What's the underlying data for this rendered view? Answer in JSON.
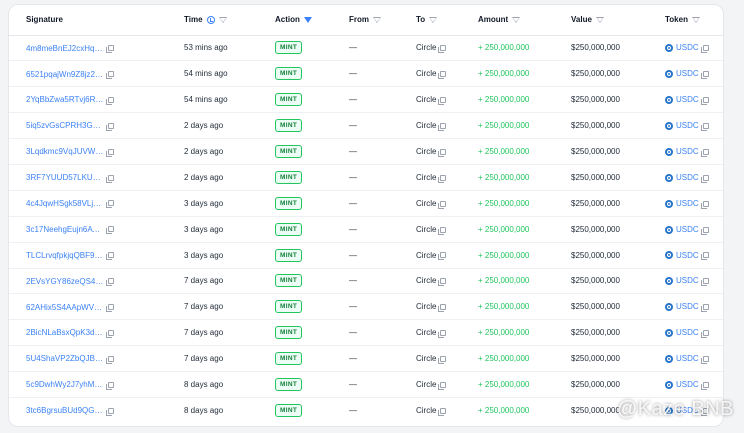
{
  "columns": {
    "signature": "Signature",
    "time": "Time",
    "action": "Action",
    "from": "From",
    "to": "To",
    "amount": "Amount",
    "value": "Value",
    "token": "Token"
  },
  "rows": [
    {
      "signature": "4m8meBnEJ2cxHqA…",
      "time": "53 mins ago",
      "action": "MINT",
      "from": "—",
      "to": "Circle",
      "amount": "+ 250,000,000",
      "value": "$250,000,000",
      "token": "USDC"
    },
    {
      "signature": "6521pqajWn9Z8jz2u…",
      "time": "54 mins ago",
      "action": "MINT",
      "from": "—",
      "to": "Circle",
      "amount": "+ 250,000,000",
      "value": "$250,000,000",
      "token": "USDC"
    },
    {
      "signature": "2YqBbZwa5RTvj6ReL…",
      "time": "54 mins ago",
      "action": "MINT",
      "from": "—",
      "to": "Circle",
      "amount": "+ 250,000,000",
      "value": "$250,000,000",
      "token": "USDC"
    },
    {
      "signature": "5iq5zvGsCPRH3GVC…",
      "time": "2 days ago",
      "action": "MINT",
      "from": "—",
      "to": "Circle",
      "amount": "+ 250,000,000",
      "value": "$250,000,000",
      "token": "USDC"
    },
    {
      "signature": "3Lqdkmc9VqJUVWC…",
      "time": "2 days ago",
      "action": "MINT",
      "from": "—",
      "to": "Circle",
      "amount": "+ 250,000,000",
      "value": "$250,000,000",
      "token": "USDC"
    },
    {
      "signature": "3RF7YUUD57LKU4M…",
      "time": "2 days ago",
      "action": "MINT",
      "from": "—",
      "to": "Circle",
      "amount": "+ 250,000,000",
      "value": "$250,000,000",
      "token": "USDC"
    },
    {
      "signature": "4c4JqwHSgk58VLjW…",
      "time": "3 days ago",
      "action": "MINT",
      "from": "—",
      "to": "Circle",
      "amount": "+ 250,000,000",
      "value": "$250,000,000",
      "token": "USDC"
    },
    {
      "signature": "3c17NeehgEujn6AT…",
      "time": "3 days ago",
      "action": "MINT",
      "from": "—",
      "to": "Circle",
      "amount": "+ 250,000,000",
      "value": "$250,000,000",
      "token": "USDC"
    },
    {
      "signature": "TLCLrvqfpkjqQBF9L4…",
      "time": "3 days ago",
      "action": "MINT",
      "from": "—",
      "to": "Circle",
      "amount": "+ 250,000,000",
      "value": "$250,000,000",
      "token": "USDC"
    },
    {
      "signature": "2EVsYGY86zeQS4jm…",
      "time": "7 days ago",
      "action": "MINT",
      "from": "—",
      "to": "Circle",
      "amount": "+ 250,000,000",
      "value": "$250,000,000",
      "token": "USDC"
    },
    {
      "signature": "62AHix5S4AApWV4J…",
      "time": "7 days ago",
      "action": "MINT",
      "from": "—",
      "to": "Circle",
      "amount": "+ 250,000,000",
      "value": "$250,000,000",
      "token": "USDC"
    },
    {
      "signature": "2BicNLaBsxQpK3dcx…",
      "time": "7 days ago",
      "action": "MINT",
      "from": "—",
      "to": "Circle",
      "amount": "+ 250,000,000",
      "value": "$250,000,000",
      "token": "USDC"
    },
    {
      "signature": "5U4ShaVP2ZbQJBed…",
      "time": "7 days ago",
      "action": "MINT",
      "from": "—",
      "to": "Circle",
      "amount": "+ 250,000,000",
      "value": "$250,000,000",
      "token": "USDC"
    },
    {
      "signature": "5c9DwhWy2J7yhMm…",
      "time": "8 days ago",
      "action": "MINT",
      "from": "—",
      "to": "Circle",
      "amount": "+ 250,000,000",
      "value": "$250,000,000",
      "token": "USDC"
    },
    {
      "signature": "3tc6BgrsuBUd9QGF8…",
      "time": "8 days ago",
      "action": "MINT",
      "from": "—",
      "to": "Circle",
      "amount": "+ 250,000,000",
      "value": "$250,000,000",
      "token": "USDC"
    }
  ],
  "watermark": "@Kaze BNB",
  "colors": {
    "link": "#3b82f6",
    "amount": "#22c55e",
    "badge_border": "#22c55e",
    "usdc": "#2775ca"
  },
  "icons": {
    "copy": "copy-icon",
    "filter": "filter-icon",
    "clock": "clock-icon",
    "usdc": "usdc-coin-icon"
  }
}
